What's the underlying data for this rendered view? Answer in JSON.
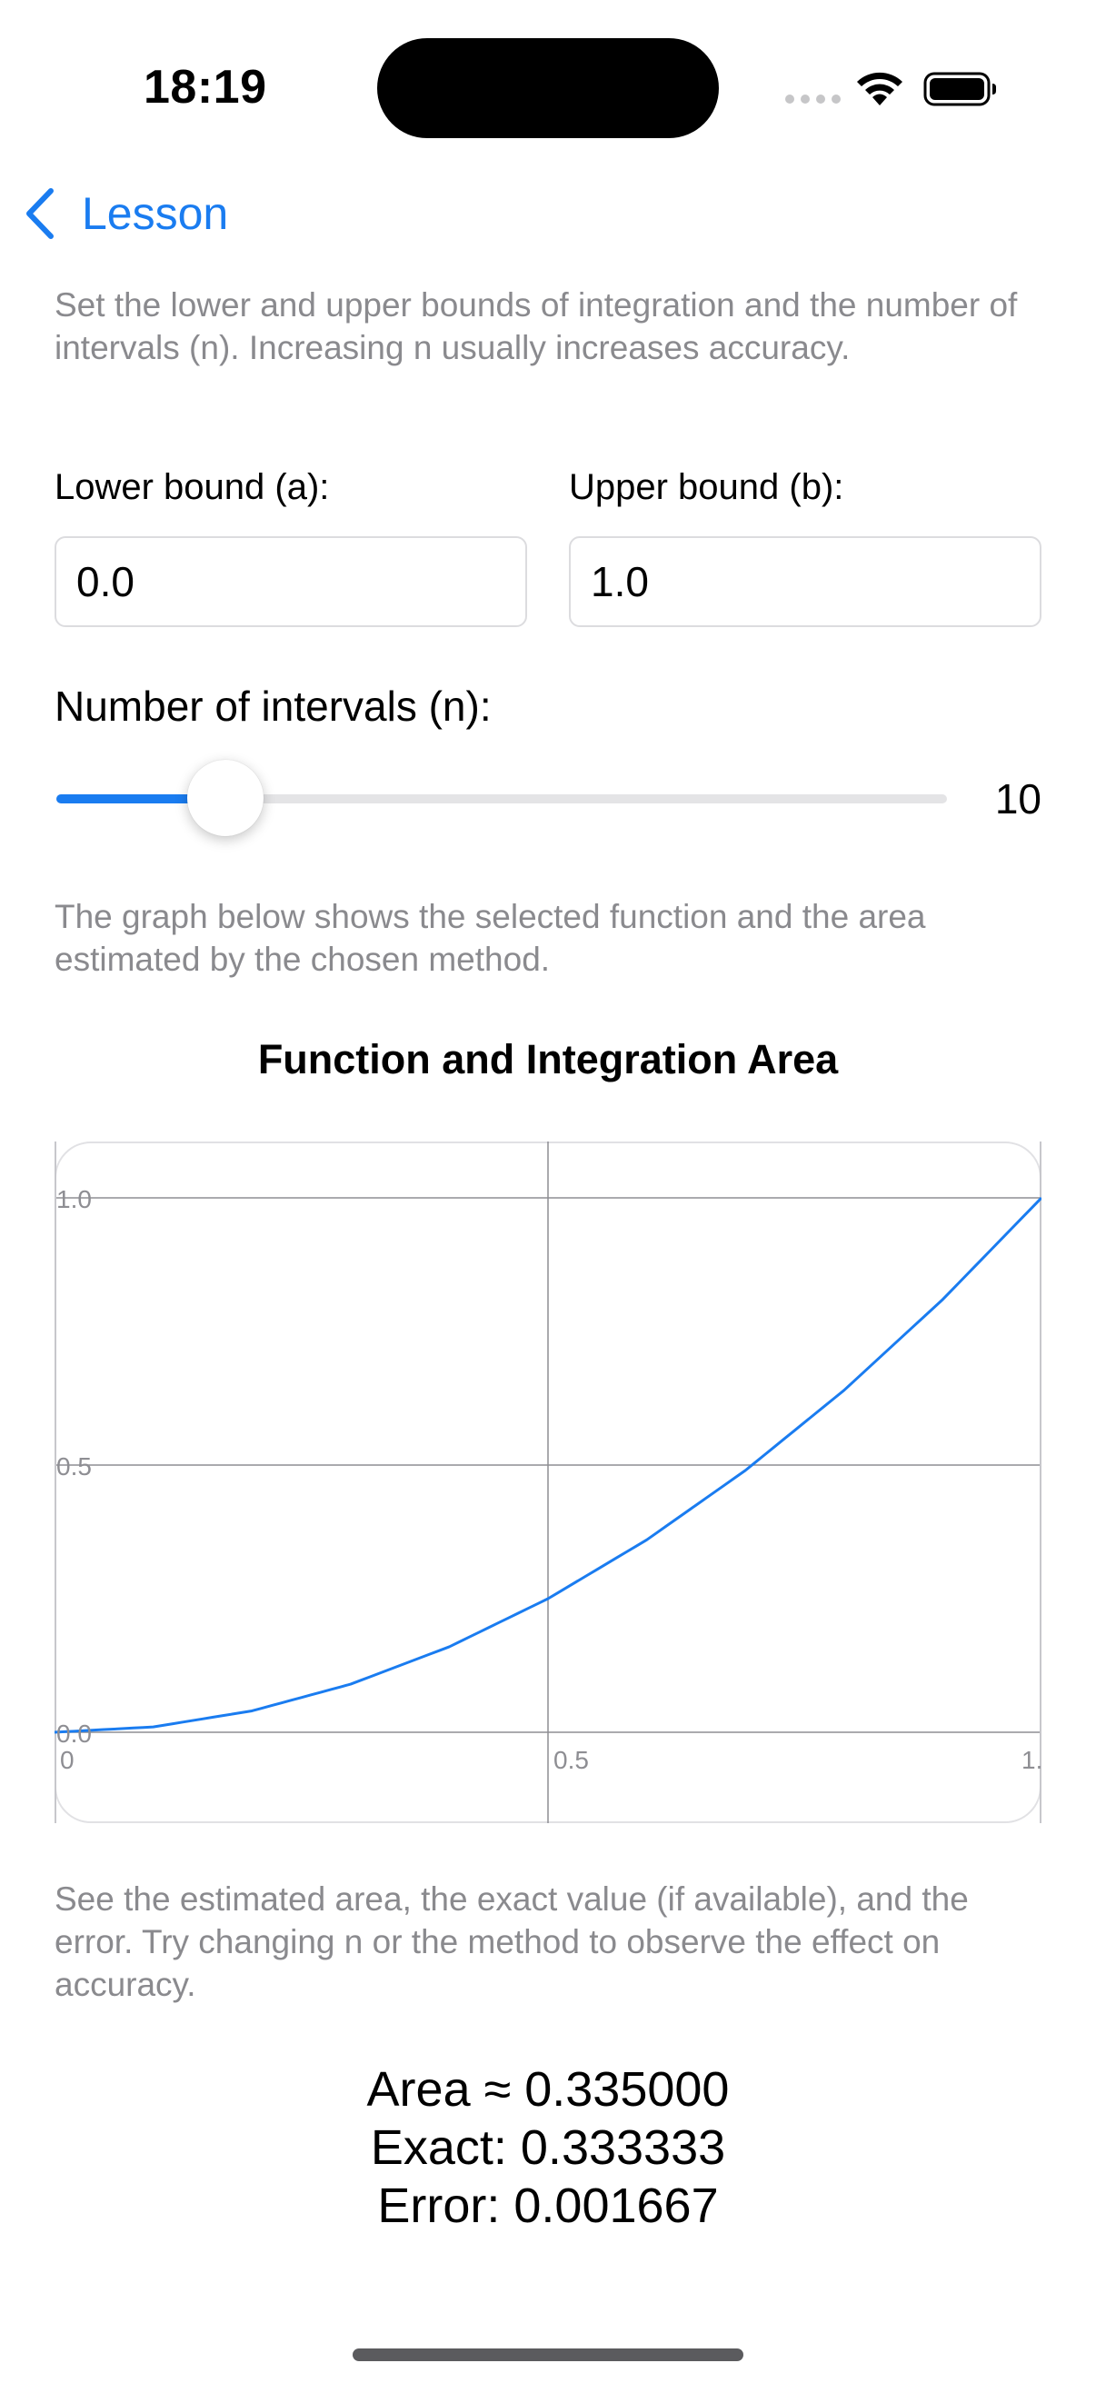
{
  "status_bar": {
    "time": "18:19"
  },
  "nav": {
    "back_label": "Lesson"
  },
  "intro_text": "Set the lower and upper bounds of integration and the number of intervals (n). Increasing n usually increases accuracy.",
  "bounds": {
    "lower_label": "Lower bound (a):",
    "lower_value": "0.0",
    "upper_label": "Upper bound (b):",
    "upper_value": "1.0"
  },
  "intervals": {
    "label": "Number of intervals (n):",
    "value": "10",
    "slider_fraction": 0.19
  },
  "graph_caption": "The graph below shows the selected function and the area estimated by the chosen method.",
  "chart_title": "Function and Integration Area",
  "chart_data": {
    "type": "line",
    "title": "Function and Integration Area",
    "xlabel": "",
    "ylabel": "",
    "xlim": [
      0,
      1
    ],
    "ylim": [
      0,
      1
    ],
    "x_ticks": [
      "0",
      "0.5",
      "1."
    ],
    "y_ticks": [
      "0.0",
      "0.5",
      "1.0"
    ],
    "grid": true,
    "series": [
      {
        "color": "#1a7cf0",
        "x": [
          0,
          0.1,
          0.2,
          0.3,
          0.4,
          0.5,
          0.6,
          0.7,
          0.8,
          0.9,
          1.0
        ],
        "y": [
          0,
          0.01,
          0.04,
          0.09,
          0.16,
          0.25,
          0.36,
          0.49,
          0.64,
          0.81,
          1.0
        ]
      }
    ]
  },
  "results_caption": "See the estimated area, the exact value (if available), and the error. Try changing n or the method to observe the effect on accuracy.",
  "results": {
    "area": "Area ≈ 0.335000",
    "exact": "Exact: 0.333333",
    "error": "Error: 0.001667"
  },
  "colors": {
    "accent": "#1a7cf0",
    "secondary_text": "#8a8a8e"
  }
}
